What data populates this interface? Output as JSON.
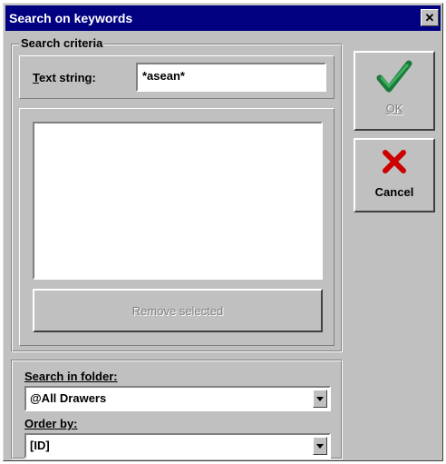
{
  "window": {
    "title": "Search on keywords"
  },
  "titlebar": {
    "close_glyph": "✕"
  },
  "criteria": {
    "legend": "Search criteria",
    "text_string_label": "Text string:",
    "text_string_value": "*asean*",
    "remove_selected_label": "Remove selected"
  },
  "folder": {
    "search_in_label": "Search in folder:",
    "search_in_value": "@All Drawers",
    "order_by_label": "Order by:",
    "order_by_value": "[ID]"
  },
  "buttons": {
    "ok_label": "OK",
    "cancel_label": "Cancel"
  },
  "colors": {
    "titlebar": "#000080",
    "ok_check": "#2e8b57",
    "cancel_x": "#cc0000"
  },
  "icons": {
    "ok": "checkmark-icon",
    "cancel": "red-x-icon",
    "dropdown": "chevron-down-icon",
    "close": "close-icon"
  }
}
